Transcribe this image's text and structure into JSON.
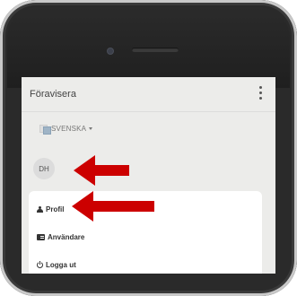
{
  "app": {
    "title": "Föravisera",
    "menu_icon": "more-vertical-icon"
  },
  "language": {
    "label": "SVENSKA",
    "icon": "flag-icon"
  },
  "user": {
    "initials": "DH"
  },
  "menu": {
    "items": [
      {
        "label": "Profil",
        "icon": "user-icon"
      },
      {
        "label": "Användare",
        "icon": "id-card-icon"
      },
      {
        "label": "Logga ut",
        "icon": "power-icon"
      }
    ]
  },
  "annotations": {
    "arrow_color": "#cc0000"
  }
}
